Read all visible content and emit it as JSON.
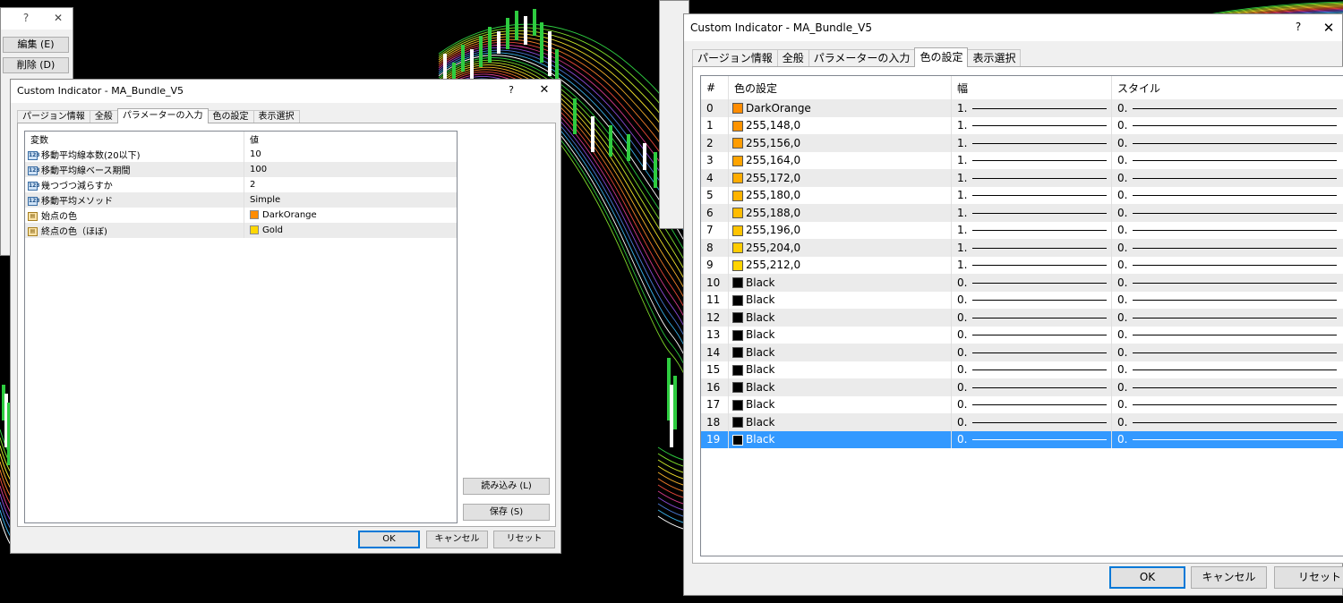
{
  "background_window": {
    "help": "?",
    "close": "✕",
    "edit_button": "編集 (E)",
    "delete_button": "削除 (D)"
  },
  "left_dialog": {
    "title": "Custom Indicator - MA_Bundle_V5",
    "help": "?",
    "close": "✕",
    "tabs": [
      "パージョン情報",
      "全般",
      "パラメーターの入力",
      "色の設定",
      "表示選択"
    ],
    "active_tab": "パラメーターの入力",
    "table_headers": [
      "変数",
      "値"
    ],
    "params": [
      {
        "icon": "numeric-param-icon",
        "name": "移動平均線本数(20以下)",
        "value": "10"
      },
      {
        "icon": "numeric-param-icon",
        "name": "移動平均線ベース期間",
        "value": "100"
      },
      {
        "icon": "numeric-param-icon",
        "name": "幾つづつ減らすか",
        "value": "2"
      },
      {
        "icon": "numeric-param-icon",
        "name": "移動平均メソッド",
        "value": "Simple"
      },
      {
        "icon": "color-param-icon",
        "name": "始点の色",
        "value": "DarkOrange",
        "swatch": "#ff8c00"
      },
      {
        "icon": "color-param-icon",
        "name": "終点の色（ほぼ)",
        "value": "Gold",
        "swatch": "#ffd700"
      }
    ],
    "load_button": "読み込み (L)",
    "save_button": "保存 (S)",
    "ok_button": "OK",
    "cancel_button": "キャンセル",
    "reset_button": "リセット"
  },
  "right_dialog": {
    "title": "Custom Indicator - MA_Bundle_V5",
    "help": "?",
    "close": "✕",
    "tabs": [
      "パージョン情報",
      "全般",
      "パラメーターの入力",
      "色の設定",
      "表示選択"
    ],
    "active_tab": "色の設定",
    "table_headers": [
      "#",
      "色の設定",
      "幅",
      "スタイル"
    ],
    "rows": [
      {
        "index": "0",
        "color": "DarkOrange",
        "swatch": "#ff8c00",
        "width": "1.",
        "style": "0."
      },
      {
        "index": "1",
        "color": "255,148,0",
        "swatch": "#ff9400",
        "width": "1.",
        "style": "0."
      },
      {
        "index": "2",
        "color": "255,156,0",
        "swatch": "#ff9c00",
        "width": "1.",
        "style": "0."
      },
      {
        "index": "3",
        "color": "255,164,0",
        "swatch": "#ffa400",
        "width": "1.",
        "style": "0."
      },
      {
        "index": "4",
        "color": "255,172,0",
        "swatch": "#ffac00",
        "width": "1.",
        "style": "0."
      },
      {
        "index": "5",
        "color": "255,180,0",
        "swatch": "#ffb400",
        "width": "1.",
        "style": "0."
      },
      {
        "index": "6",
        "color": "255,188,0",
        "swatch": "#ffbc00",
        "width": "1.",
        "style": "0."
      },
      {
        "index": "7",
        "color": "255,196,0",
        "swatch": "#ffc400",
        "width": "1.",
        "style": "0."
      },
      {
        "index": "8",
        "color": "255,204,0",
        "swatch": "#ffcc00",
        "width": "1.",
        "style": "0."
      },
      {
        "index": "9",
        "color": "255,212,0",
        "swatch": "#ffd400",
        "width": "1.",
        "style": "0."
      },
      {
        "index": "10",
        "color": "Black",
        "swatch": "#000000",
        "width": "0.",
        "style": "0."
      },
      {
        "index": "11",
        "color": "Black",
        "swatch": "#000000",
        "width": "0.",
        "style": "0."
      },
      {
        "index": "12",
        "color": "Black",
        "swatch": "#000000",
        "width": "0.",
        "style": "0."
      },
      {
        "index": "13",
        "color": "Black",
        "swatch": "#000000",
        "width": "0.",
        "style": "0."
      },
      {
        "index": "14",
        "color": "Black",
        "swatch": "#000000",
        "width": "0.",
        "style": "0."
      },
      {
        "index": "15",
        "color": "Black",
        "swatch": "#000000",
        "width": "0.",
        "style": "0."
      },
      {
        "index": "16",
        "color": "Black",
        "swatch": "#000000",
        "width": "0.",
        "style": "0."
      },
      {
        "index": "17",
        "color": "Black",
        "swatch": "#000000",
        "width": "0.",
        "style": "0."
      },
      {
        "index": "18",
        "color": "Black",
        "swatch": "#000000",
        "width": "0.",
        "style": "0."
      },
      {
        "index": "19",
        "color": "Black",
        "swatch": "#000000",
        "width": "0.",
        "style": "0."
      }
    ],
    "selected_row": "19",
    "ok_button": "OK",
    "cancel_button": "キャンセル",
    "reset_button": "リセット"
  },
  "colors": {
    "selection": "#3399ff",
    "alt_row": "#ebebeb",
    "default_button_border": "#0078d7"
  }
}
